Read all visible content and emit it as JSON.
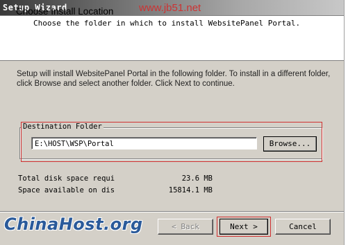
{
  "window": {
    "title": "Setup Wizard",
    "close_glyph": "×"
  },
  "watermark_top": "www.jb51.net",
  "watermark_logo": "ChinaHost.org",
  "header": {
    "title": "Choose Install Location",
    "subtitle": "Choose the folder in which to install WebsitePanel Portal."
  },
  "description": "Setup will install WebsitePanel Portal in the following folder. To install in a different folder, click Browse and select another folder. Click Next to continue.",
  "destination": {
    "group_label": "Destination Folder",
    "path_value": "E:\\HOST\\WSP\\Portal",
    "browse_label": "Browse..."
  },
  "disk": {
    "required_label": "Total disk space requi",
    "required_value": "23.6 MB",
    "available_label": "Space available on dis",
    "available_value": "15814.1 MB"
  },
  "buttons": {
    "back_label": "< Back",
    "next_label": "Next >",
    "cancel_label": "Cancel"
  },
  "colors": {
    "dialog_bg": "#d4d0c8",
    "highlight_outline": "#d03030"
  }
}
